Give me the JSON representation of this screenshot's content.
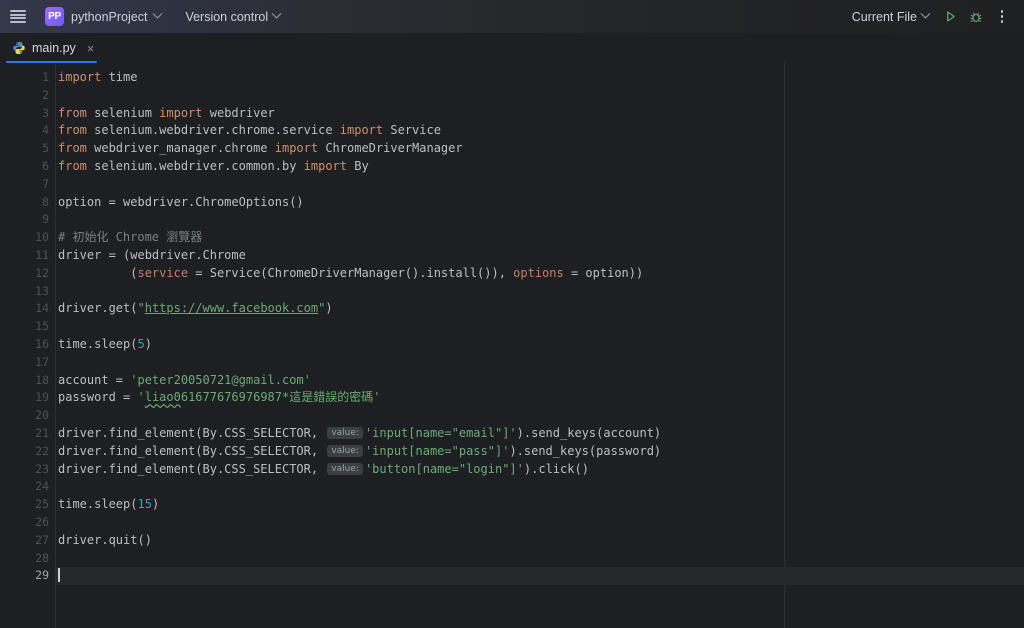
{
  "toolbar": {
    "menu_icon": "hamburger-menu-icon",
    "project_badge": "PP",
    "project_name": "pythonProject",
    "version_control": "Version control",
    "run_config": "Current File",
    "run_icon": "run-play-icon",
    "debug_icon": "debug-bug-icon",
    "more_icon": "more-vertical-icon",
    "accent_blue": "#3574f0",
    "logo_purple": "#7f5af0",
    "run_green": "#5fad65"
  },
  "tabs": [
    {
      "label": "main.py",
      "icon": "python-file-icon",
      "close": "×",
      "active": true
    }
  ],
  "editor": {
    "total_lines": 29,
    "cursor_line": 29,
    "lines": [
      {
        "n": 1,
        "tokens": [
          {
            "t": "import",
            "c": "kw"
          },
          {
            "t": " time",
            "c": "plain"
          }
        ]
      },
      {
        "n": 2,
        "tokens": []
      },
      {
        "n": 3,
        "tokens": [
          {
            "t": "from",
            "c": "kw"
          },
          {
            "t": " selenium ",
            "c": "plain"
          },
          {
            "t": "import",
            "c": "kw"
          },
          {
            "t": " webdriver",
            "c": "plain"
          }
        ]
      },
      {
        "n": 4,
        "tokens": [
          {
            "t": "from",
            "c": "kw"
          },
          {
            "t": " selenium.webdriver.chrome.service ",
            "c": "plain"
          },
          {
            "t": "import",
            "c": "kw"
          },
          {
            "t": " Service",
            "c": "plain"
          }
        ]
      },
      {
        "n": 5,
        "tokens": [
          {
            "t": "from",
            "c": "kw"
          },
          {
            "t": " webdriver_manager.chrome ",
            "c": "plain"
          },
          {
            "t": "import",
            "c": "kw"
          },
          {
            "t": " ChromeDriverManager",
            "c": "plain"
          }
        ]
      },
      {
        "n": 6,
        "tokens": [
          {
            "t": "from",
            "c": "kw"
          },
          {
            "t": " selenium.webdriver.common.by ",
            "c": "plain"
          },
          {
            "t": "import",
            "c": "kw"
          },
          {
            "t": " By",
            "c": "plain"
          }
        ]
      },
      {
        "n": 7,
        "tokens": []
      },
      {
        "n": 8,
        "tokens": [
          {
            "t": "option = webdriver.ChromeOptions()",
            "c": "plain"
          }
        ]
      },
      {
        "n": 9,
        "tokens": []
      },
      {
        "n": 10,
        "tokens": [
          {
            "t": "# 初始化 Chrome 瀏覽器",
            "c": "cmt"
          }
        ]
      },
      {
        "n": 11,
        "tokens": [
          {
            "t": "driver = (webdriver.Chrome",
            "c": "plain"
          }
        ]
      },
      {
        "n": 12,
        "tokens": [
          {
            "t": "          (",
            "c": "plain"
          },
          {
            "t": "service",
            "c": "named"
          },
          {
            "t": " = Service(ChromeDriverManager().install()), ",
            "c": "plain"
          },
          {
            "t": "options",
            "c": "named"
          },
          {
            "t": " = option))",
            "c": "plain"
          }
        ]
      },
      {
        "n": 13,
        "tokens": []
      },
      {
        "n": 14,
        "tokens": [
          {
            "t": "driver.get(",
            "c": "plain"
          },
          {
            "t": "\"",
            "c": "str"
          },
          {
            "t": "https://www.facebook.com",
            "c": "url"
          },
          {
            "t": "\"",
            "c": "str"
          },
          {
            "t": ")",
            "c": "plain"
          }
        ]
      },
      {
        "n": 15,
        "tokens": []
      },
      {
        "n": 16,
        "tokens": [
          {
            "t": "time.sleep(",
            "c": "plain"
          },
          {
            "t": "5",
            "c": "num"
          },
          {
            "t": ")",
            "c": "plain"
          }
        ]
      },
      {
        "n": 17,
        "tokens": []
      },
      {
        "n": 18,
        "tokens": [
          {
            "t": "account = ",
            "c": "plain"
          },
          {
            "t": "'peter20050721@gmail.com'",
            "c": "str"
          }
        ]
      },
      {
        "n": 19,
        "tokens": [
          {
            "t": "password = ",
            "c": "plain"
          },
          {
            "t": "'",
            "c": "str"
          },
          {
            "t": "liao0",
            "c": "str typo"
          },
          {
            "t": "61677676976987*這是錯誤的密碼'",
            "c": "str"
          }
        ]
      },
      {
        "n": 20,
        "tokens": []
      },
      {
        "n": 21,
        "tokens": [
          {
            "t": "driver.find_element(By.CSS_SELECTOR, ",
            "c": "plain"
          },
          {
            "t": "value:",
            "c": "hint"
          },
          {
            "t": "'input[name=\"email\"]'",
            "c": "str"
          },
          {
            "t": ").send_keys(account)",
            "c": "plain"
          }
        ]
      },
      {
        "n": 22,
        "tokens": [
          {
            "t": "driver.find_element(By.CSS_SELECTOR, ",
            "c": "plain"
          },
          {
            "t": "value:",
            "c": "hint"
          },
          {
            "t": "'input[name=\"pass\"]'",
            "c": "str"
          },
          {
            "t": ").send_keys(password)",
            "c": "plain"
          }
        ]
      },
      {
        "n": 23,
        "tokens": [
          {
            "t": "driver.find_element(By.CSS_SELECTOR, ",
            "c": "plain"
          },
          {
            "t": "value:",
            "c": "hint"
          },
          {
            "t": "'button[name=\"login\"]'",
            "c": "str"
          },
          {
            "t": ").click()",
            "c": "plain"
          }
        ]
      },
      {
        "n": 24,
        "tokens": []
      },
      {
        "n": 25,
        "tokens": [
          {
            "t": "time.sleep(",
            "c": "plain"
          },
          {
            "t": "15",
            "c": "num"
          },
          {
            "t": ")",
            "c": "plain"
          }
        ]
      },
      {
        "n": 26,
        "tokens": []
      },
      {
        "n": 27,
        "tokens": [
          {
            "t": "driver.quit()",
            "c": "plain"
          }
        ]
      },
      {
        "n": 28,
        "tokens": []
      },
      {
        "n": 29,
        "tokens": [
          {
            "t": "",
            "c": "caret"
          }
        ]
      }
    ]
  }
}
